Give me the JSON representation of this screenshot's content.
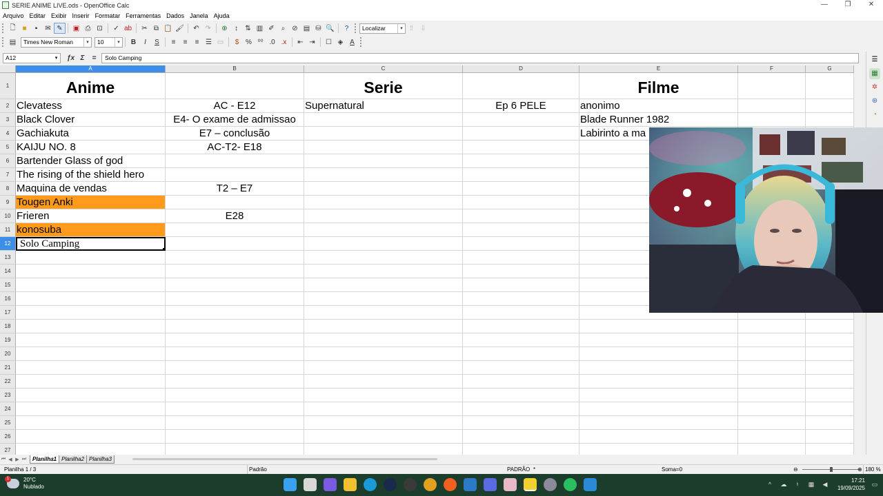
{
  "window": {
    "title": "SERIE ANIME LIVE.ods - OpenOffice Calc",
    "minimize": "—",
    "maximize": "❐",
    "close": "✕"
  },
  "menu": [
    "Arquivo",
    "Editar",
    "Exibir",
    "Inserir",
    "Formatar",
    "Ferramentas",
    "Dados",
    "Janela",
    "Ajuda"
  ],
  "toolbar": {
    "find_placeholder": "Localizar",
    "font_name": "Times New Roman",
    "font_size": "10"
  },
  "formula_bar": {
    "cell_ref": "A12",
    "content": "Solo Camping"
  },
  "columns": [
    "A",
    "B",
    "C",
    "D",
    "E",
    "F",
    "G"
  ],
  "selected_column": "A",
  "selected_row": "12",
  "rows": [
    "1",
    "2",
    "3",
    "4",
    "5",
    "6",
    "7",
    "8",
    "9",
    "10",
    "11",
    "12",
    "13",
    "14",
    "15",
    "16",
    "17",
    "18",
    "19",
    "20",
    "21",
    "22",
    "23",
    "24",
    "25",
    "26",
    "27"
  ],
  "cells": {
    "A1": "Anime",
    "C1": "Serie",
    "E1": "Filme",
    "A2": "Clevatess",
    "B2": "AC - E12",
    "C2": "Supernatural",
    "D2": "Ep 6 PELE",
    "E2": "anonimo",
    "A3": "Black Clover",
    "B3": "E4- O exame de admissao",
    "E3": "Blade Runner 1982",
    "A4": "Gachiakuta",
    "B4": "E7 – conclusão",
    "E4": "Labirinto a ma",
    "A5": "KAIJU NO. 8",
    "B5": "AC-T2- E18",
    "A6": "Bartender Glass of god",
    "A7": "The rising of the shield hero",
    "A8": "Maquina de vendas",
    "B8": "T2 – E7",
    "A9": "Tougen Anki",
    "A10": "Frieren",
    "B10": "E28",
    "A11": "konosuba",
    "A12": "Solo Camping"
  },
  "highlight_color": "#ff9a1a",
  "sheets": [
    "Planilha1",
    "Planilha2",
    "Planilha3"
  ],
  "active_sheet": "Planilha1",
  "status": {
    "sheet_info": "Planilha 1 / 3",
    "page_style": "Padrão",
    "mode": "PADRÃO",
    "mode_star": "*",
    "sum": "Soma=0",
    "zoom": "180 %",
    "zoom_minus": "⊖",
    "zoom_plus": "⊕"
  },
  "taskbar": {
    "weather_temp": "20°C",
    "weather_desc": "Nublado",
    "weather_badge": "1",
    "time": "17:21",
    "date": "19/09/2025"
  }
}
